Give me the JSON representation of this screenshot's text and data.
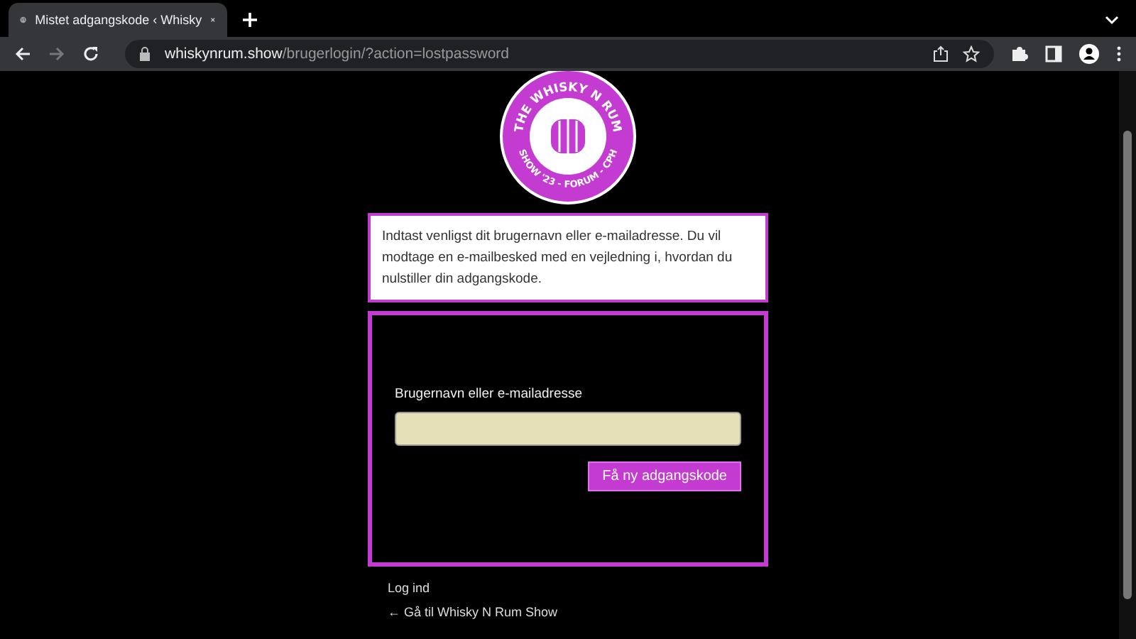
{
  "browser": {
    "tab_title": "Mistet adgangskode ‹ Whisky",
    "url_host": "whiskynrum.show",
    "url_path": "/brugerlogin/?action=lostpassword"
  },
  "logo": {
    "top_text": "THE WHISKY N RUM",
    "bottom_text": "SHOW '23 - FORUM - CPH"
  },
  "message": "Indtast venligst dit brugernavn eller e-mailadresse. Du vil modtage en e-mailbesked med en vejledning i, hvordan du nulstiller din adgangskode.",
  "form": {
    "field_label": "Brugernavn eller e-mailadresse",
    "submit": "Få ny adgangskode"
  },
  "links": [
    "Log ind",
    "← Gå til Whisky N Rum Show"
  ]
}
